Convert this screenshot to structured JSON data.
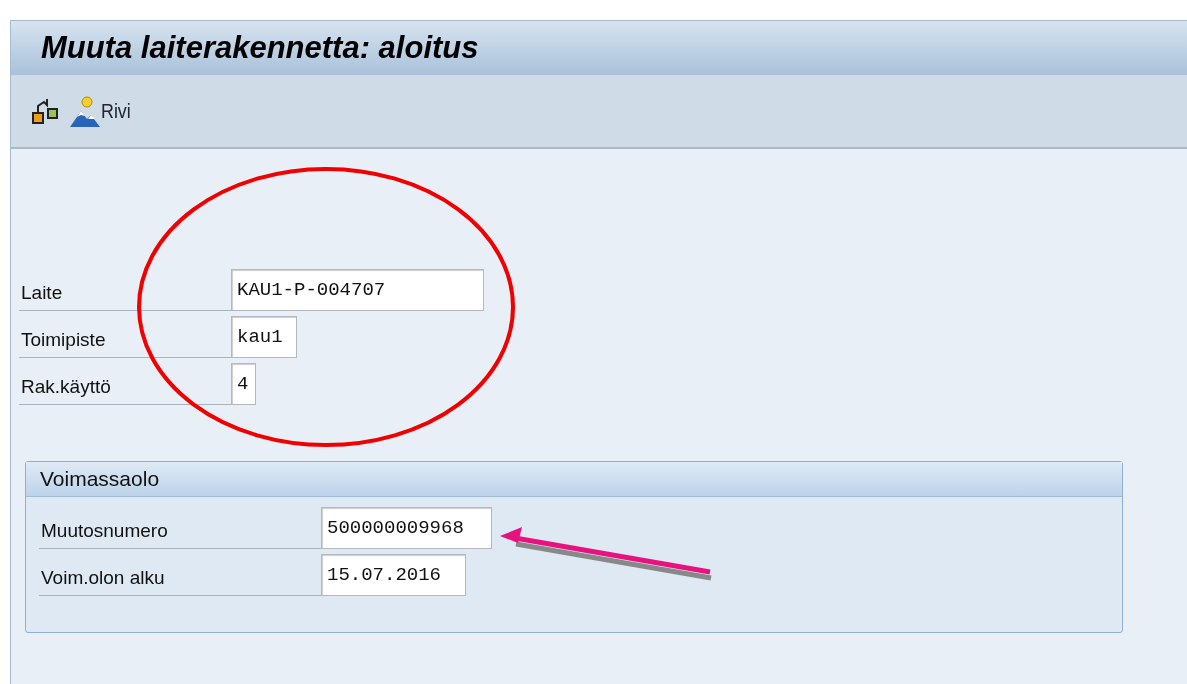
{
  "window": {
    "title": "Muuta laiterakennetta: aloitus"
  },
  "toolbar": [
    {
      "kind": "structure"
    },
    {
      "kind": "person",
      "label": "Rivi"
    }
  ],
  "fields": [
    {
      "label": "Laite",
      "value": "KAU1-P-004707"
    },
    {
      "label": "Toimipiste",
      "value": "kau1"
    },
    {
      "label": "Rak.käyttö",
      "value": "4"
    }
  ],
  "group": {
    "title": "Voimassaolo",
    "fields": [
      {
        "label": "Muutosnumero",
        "value": "500000009968"
      },
      {
        "label": "Voim.olon alku",
        "value": "15.07.2016"
      }
    ]
  }
}
